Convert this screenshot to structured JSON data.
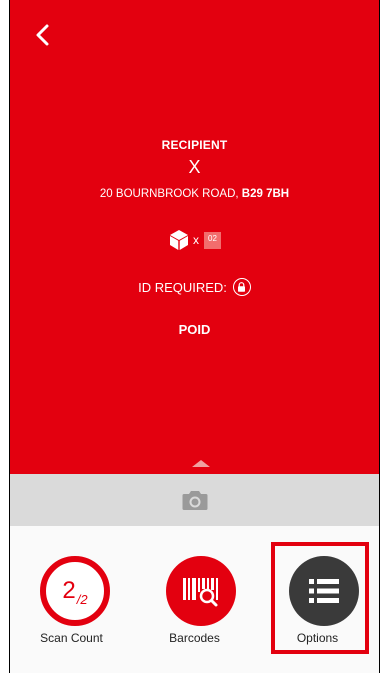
{
  "delivery": {
    "recipient_label": "RECIPIENT",
    "recipient_name": "X",
    "address_street": "20 BOURNBROOK ROAD, ",
    "address_postcode": "B29 7BH",
    "parcel_multiplier": "x",
    "parcel_count": "02",
    "id_required_label": "ID REQUIRED:",
    "service_code": "POID"
  },
  "actions": {
    "scan_count": {
      "label": "Scan Count",
      "scanned": "2",
      "total": "/2"
    },
    "barcodes": {
      "label": "Barcodes"
    },
    "options": {
      "label": "Options"
    }
  },
  "colors": {
    "brand_red": "#e3000f",
    "options_dark": "#3a3a3a",
    "camera_bar": "#dadada"
  },
  "icons": [
    "back-arrow-icon",
    "parcel-box-icon",
    "lock-icon",
    "expand-up-icon",
    "camera-icon",
    "barcode-scan-icon",
    "list-icon"
  ]
}
